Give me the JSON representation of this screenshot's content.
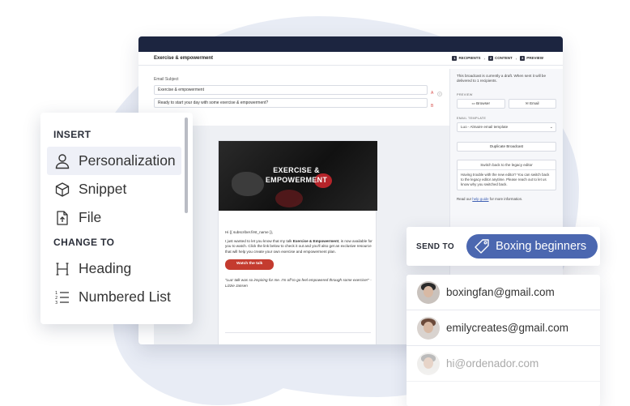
{
  "editor": {
    "title": "Exercise & empowerment",
    "steps": [
      {
        "num": "1",
        "label": "RECIPIENTS"
      },
      {
        "num": "2",
        "label": "CONTENT"
      },
      {
        "num": "3",
        "label": "PREVIEW"
      }
    ],
    "subject_label": "Email Subject",
    "subject_a": "Exercise & empowerment",
    "subject_b": "Ready to start your day with some exercise & empowerment?",
    "badge_a": "A",
    "badge_b": "B"
  },
  "email": {
    "hero_title": "EXERCISE & EMPOWERMENT",
    "greeting": "Hi {{ subscriber.first_name }},",
    "body_pre": "I just wanted to let you know that my talk ",
    "body_bold": "Exercise & Empowerment",
    "body_post": ", is now available for you to watch. Click the link below to check it out and you'll also get an exclusive resource that will help you create your own exercise and empowerment plan.",
    "cta": "Watch the talk",
    "quote": "\"Lua' talk was so inspiring for me. I'm off to go feel empowered through some exercise!\" - Lizzie Jansen"
  },
  "right_panel": {
    "draft_note": "This broadcast is currently a draft. When sent it will be delivered to 1 recipients.",
    "preview_label": "PREVIEW",
    "browser_btn": "Browser",
    "email_btn": "Email",
    "template_label": "EMAIL TEMPLATE",
    "template_value": "Luo - Almaire email template",
    "duplicate_btn": "Duplicate Broadcast",
    "legacy_head": "Switch back to the legacy editor",
    "legacy_body": "Having trouble with the new editor? You can switch back to the legacy editor anytime. Please reach out to let us know why you switched back.",
    "foot_pre": "Read our ",
    "foot_link": "help guide",
    "foot_post": " for more information."
  },
  "menu": {
    "insert_heading": "INSERT",
    "insert_items": [
      {
        "label": "Personalization",
        "icon": "person-icon"
      },
      {
        "label": "Snippet",
        "icon": "cube-icon"
      },
      {
        "label": "File",
        "icon": "file-upload-icon"
      }
    ],
    "change_heading": "CHANGE TO",
    "change_items": [
      {
        "label": "Heading",
        "icon": "heading-icon"
      },
      {
        "label": "Numbered List",
        "icon": "numbered-list-icon"
      }
    ]
  },
  "send_to": {
    "label": "SEND TO",
    "tag": "Boxing beginners",
    "tag_color": "#4b67b0"
  },
  "contacts": [
    {
      "email": "boxingfan@gmail.com"
    },
    {
      "email": "emilycreates@gmail.com"
    },
    {
      "email": "hi@ordenador.com"
    }
  ]
}
